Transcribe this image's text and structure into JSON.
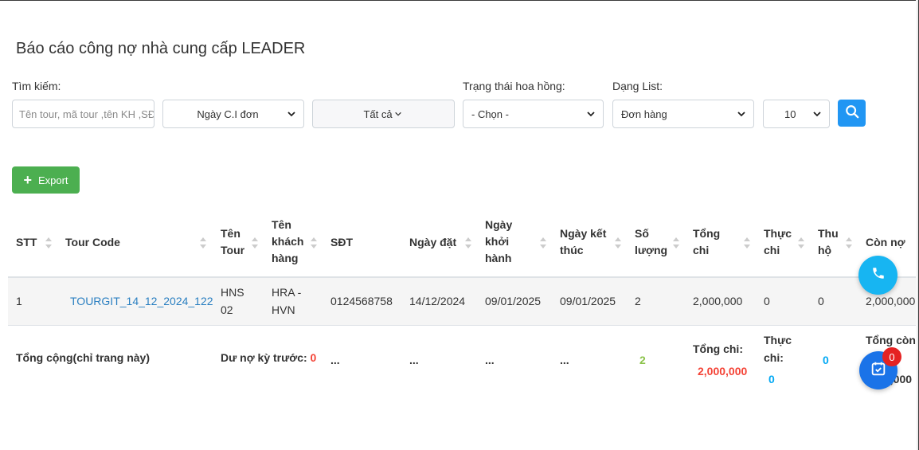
{
  "page": {
    "title": "Báo cáo công nợ nhà cung cấp LEADER"
  },
  "filters": {
    "search_label": "Tìm kiếm:",
    "search_placeholder": "Tên tour, mã tour ,tên KH ,SĐT",
    "date_select": "Ngày C.I đơn",
    "date_range": "Tất cả",
    "commission_label": "Trạng thái hoa hồng:",
    "commission_select": "- Chọn -",
    "list_label": "Dạng List:",
    "list_select": "Đơn hàng",
    "page_size": "10"
  },
  "actions": {
    "export_label": "Export"
  },
  "table": {
    "headers": {
      "stt": "STT",
      "tour_code": "Tour Code",
      "tour_name": [
        "Tên",
        "Tour"
      ],
      "customer": [
        "Tên",
        "khách",
        "hàng"
      ],
      "phone": "SĐT",
      "order_date": "Ngày đặt",
      "start_date": [
        "Ngày",
        "khởi",
        "hành"
      ],
      "end_date": [
        "Ngày kết",
        "thúc"
      ],
      "quantity": [
        "Số",
        "lượng"
      ],
      "total_spend": [
        "Tổng",
        "chi"
      ],
      "actual_spend": [
        "Thực",
        "chi"
      ],
      "collected": [
        "Thu",
        "hộ"
      ],
      "remaining": "Còn nợ"
    },
    "rows": [
      {
        "stt": "1",
        "tour_code": "TOURGIT_14_12_2024_122",
        "tour_name": [
          "HNS",
          "02"
        ],
        "customer": [
          "HRA -",
          "HVN"
        ],
        "phone": "0124568758",
        "order_date": "14/12/2024",
        "start_date": "09/01/2025",
        "end_date": "09/01/2025",
        "quantity": "2",
        "total_spend": "2,000,000",
        "actual_spend": "0",
        "collected": "0",
        "remaining": "2,000,000"
      }
    ],
    "footer": {
      "label": "Tổng cộng(chỉ trang này)",
      "prev_debt_label": "Dư nợ kỳ trước:",
      "prev_debt_value": "0",
      "ellipsis": "...",
      "quantity": "2",
      "total_spend_label": "Tổng chi:",
      "total_spend_value": "2,000,000",
      "actual_spend_label": [
        "Thực",
        "chi:"
      ],
      "actual_spend_value": "0",
      "collected_value": "0",
      "remaining_label": "Tổng còn",
      "remaining_value": "0,000"
    }
  },
  "fab": {
    "cart_badge": "0"
  },
  "colors": {
    "primary": "#2196f3",
    "success": "#4caf50",
    "danger": "#f44336",
    "link": "#2a7fc1",
    "phone_fab": "#17b5f2",
    "calendar_fab": "#1a73e8"
  },
  "icons": [
    "search-icon",
    "plus-icon",
    "chevron-down-icon",
    "sort-icon",
    "phone-icon",
    "calendar-check-icon"
  ]
}
